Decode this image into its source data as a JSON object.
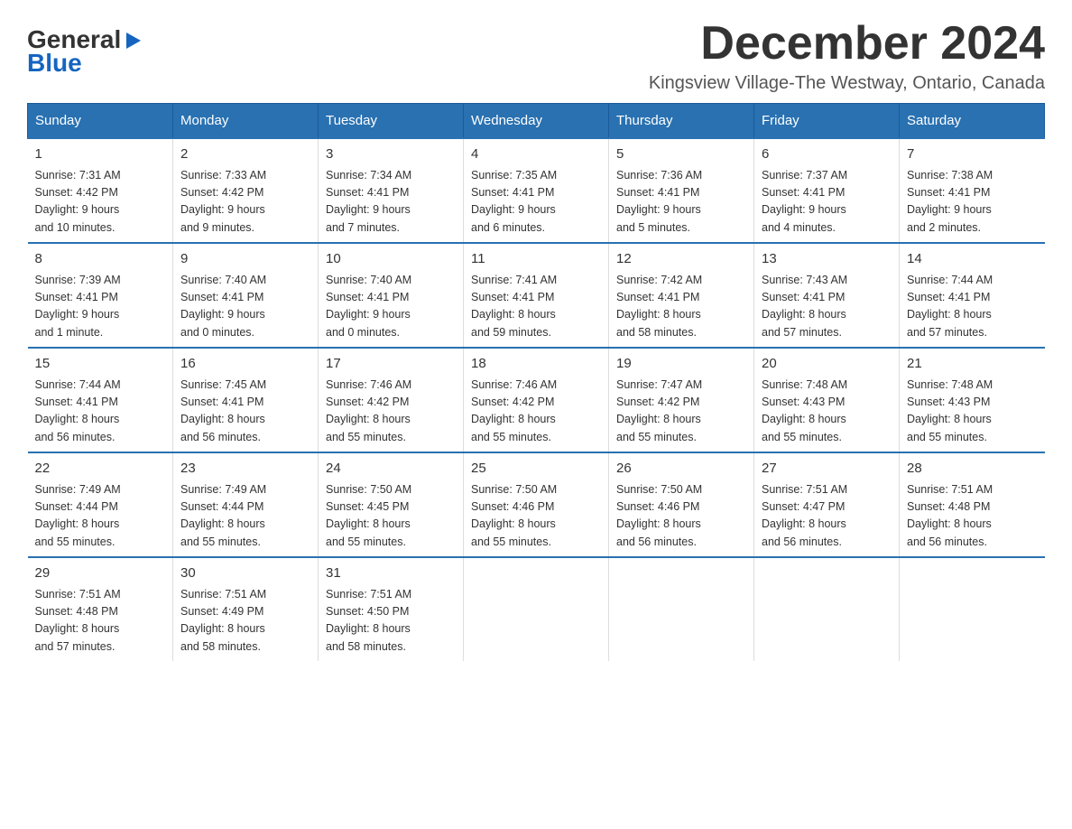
{
  "logo": {
    "line1": "General",
    "line2": "Blue",
    "arrow": "▶"
  },
  "title": "December 2024",
  "location": "Kingsview Village-The Westway, Ontario, Canada",
  "days": [
    "Sunday",
    "Monday",
    "Tuesday",
    "Wednesday",
    "Thursday",
    "Friday",
    "Saturday"
  ],
  "weeks": [
    [
      {
        "num": "1",
        "sunrise": "7:31 AM",
        "sunset": "4:42 PM",
        "daylight": "9 hours and 10 minutes."
      },
      {
        "num": "2",
        "sunrise": "7:33 AM",
        "sunset": "4:42 PM",
        "daylight": "9 hours and 9 minutes."
      },
      {
        "num": "3",
        "sunrise": "7:34 AM",
        "sunset": "4:41 PM",
        "daylight": "9 hours and 7 minutes."
      },
      {
        "num": "4",
        "sunrise": "7:35 AM",
        "sunset": "4:41 PM",
        "daylight": "9 hours and 6 minutes."
      },
      {
        "num": "5",
        "sunrise": "7:36 AM",
        "sunset": "4:41 PM",
        "daylight": "9 hours and 5 minutes."
      },
      {
        "num": "6",
        "sunrise": "7:37 AM",
        "sunset": "4:41 PM",
        "daylight": "9 hours and 4 minutes."
      },
      {
        "num": "7",
        "sunrise": "7:38 AM",
        "sunset": "4:41 PM",
        "daylight": "9 hours and 2 minutes."
      }
    ],
    [
      {
        "num": "8",
        "sunrise": "7:39 AM",
        "sunset": "4:41 PM",
        "daylight": "9 hours and 1 minute."
      },
      {
        "num": "9",
        "sunrise": "7:40 AM",
        "sunset": "4:41 PM",
        "daylight": "9 hours and 0 minutes."
      },
      {
        "num": "10",
        "sunrise": "7:40 AM",
        "sunset": "4:41 PM",
        "daylight": "9 hours and 0 minutes."
      },
      {
        "num": "11",
        "sunrise": "7:41 AM",
        "sunset": "4:41 PM",
        "daylight": "8 hours and 59 minutes."
      },
      {
        "num": "12",
        "sunrise": "7:42 AM",
        "sunset": "4:41 PM",
        "daylight": "8 hours and 58 minutes."
      },
      {
        "num": "13",
        "sunrise": "7:43 AM",
        "sunset": "4:41 PM",
        "daylight": "8 hours and 57 minutes."
      },
      {
        "num": "14",
        "sunrise": "7:44 AM",
        "sunset": "4:41 PM",
        "daylight": "8 hours and 57 minutes."
      }
    ],
    [
      {
        "num": "15",
        "sunrise": "7:44 AM",
        "sunset": "4:41 PM",
        "daylight": "8 hours and 56 minutes."
      },
      {
        "num": "16",
        "sunrise": "7:45 AM",
        "sunset": "4:41 PM",
        "daylight": "8 hours and 56 minutes."
      },
      {
        "num": "17",
        "sunrise": "7:46 AM",
        "sunset": "4:42 PM",
        "daylight": "8 hours and 55 minutes."
      },
      {
        "num": "18",
        "sunrise": "7:46 AM",
        "sunset": "4:42 PM",
        "daylight": "8 hours and 55 minutes."
      },
      {
        "num": "19",
        "sunrise": "7:47 AM",
        "sunset": "4:42 PM",
        "daylight": "8 hours and 55 minutes."
      },
      {
        "num": "20",
        "sunrise": "7:48 AM",
        "sunset": "4:43 PM",
        "daylight": "8 hours and 55 minutes."
      },
      {
        "num": "21",
        "sunrise": "7:48 AM",
        "sunset": "4:43 PM",
        "daylight": "8 hours and 55 minutes."
      }
    ],
    [
      {
        "num": "22",
        "sunrise": "7:49 AM",
        "sunset": "4:44 PM",
        "daylight": "8 hours and 55 minutes."
      },
      {
        "num": "23",
        "sunrise": "7:49 AM",
        "sunset": "4:44 PM",
        "daylight": "8 hours and 55 minutes."
      },
      {
        "num": "24",
        "sunrise": "7:50 AM",
        "sunset": "4:45 PM",
        "daylight": "8 hours and 55 minutes."
      },
      {
        "num": "25",
        "sunrise": "7:50 AM",
        "sunset": "4:46 PM",
        "daylight": "8 hours and 55 minutes."
      },
      {
        "num": "26",
        "sunrise": "7:50 AM",
        "sunset": "4:46 PM",
        "daylight": "8 hours and 56 minutes."
      },
      {
        "num": "27",
        "sunrise": "7:51 AM",
        "sunset": "4:47 PM",
        "daylight": "8 hours and 56 minutes."
      },
      {
        "num": "28",
        "sunrise": "7:51 AM",
        "sunset": "4:48 PM",
        "daylight": "8 hours and 56 minutes."
      }
    ],
    [
      {
        "num": "29",
        "sunrise": "7:51 AM",
        "sunset": "4:48 PM",
        "daylight": "8 hours and 57 minutes."
      },
      {
        "num": "30",
        "sunrise": "7:51 AM",
        "sunset": "4:49 PM",
        "daylight": "8 hours and 58 minutes."
      },
      {
        "num": "31",
        "sunrise": "7:51 AM",
        "sunset": "4:50 PM",
        "daylight": "8 hours and 58 minutes."
      },
      null,
      null,
      null,
      null
    ]
  ],
  "labels": {
    "sunrise": "Sunrise:",
    "sunset": "Sunset:",
    "daylight": "Daylight:"
  }
}
